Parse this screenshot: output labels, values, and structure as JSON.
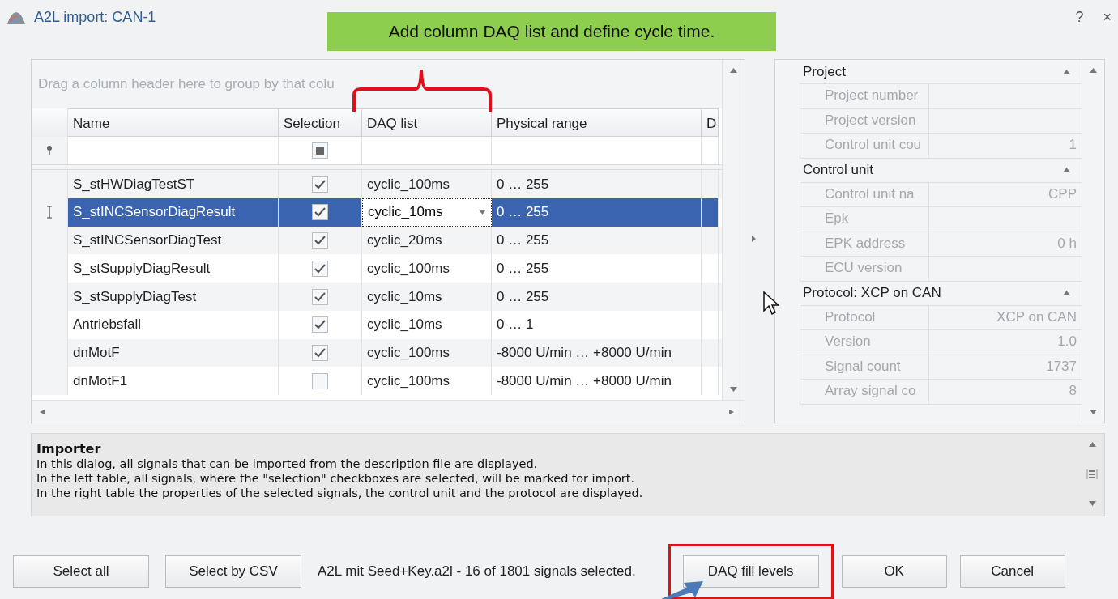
{
  "window": {
    "title": "A2L import: CAN-1",
    "help": "?",
    "close": "×"
  },
  "callout": {
    "text": "Add column DAQ list and define cycle time."
  },
  "grid": {
    "group_hint": "Drag a column header here to group by that colu",
    "columns": [
      {
        "label": "Name"
      },
      {
        "label": "Selection"
      },
      {
        "label": "DAQ list"
      },
      {
        "label": "Physical range"
      },
      {
        "label": "D"
      }
    ],
    "filter_indeterminate": true,
    "rows": [
      {
        "name": "S_stHWDiagTestST",
        "checked": true,
        "selected": false,
        "daq_list": "cyclic_100ms",
        "range": "0 … 255"
      },
      {
        "name": "S_stINCSensorDiagResult",
        "checked": true,
        "selected": true,
        "daq_list": "cyclic_10ms",
        "range": "0 … 255"
      },
      {
        "name": "S_stINCSensorDiagTest",
        "checked": true,
        "selected": false,
        "daq_list": "cyclic_20ms",
        "range": "0 … 255"
      },
      {
        "name": "S_stSupplyDiagResult",
        "checked": true,
        "selected": false,
        "daq_list": "cyclic_100ms",
        "range": "0 … 255"
      },
      {
        "name": "S_stSupplyDiagTest",
        "checked": true,
        "selected": false,
        "daq_list": "cyclic_10ms",
        "range": "0 … 255"
      },
      {
        "name": "Antriebsfall",
        "checked": true,
        "selected": false,
        "daq_list": "cyclic_10ms",
        "range": "0 … 1"
      },
      {
        "name": "dnMotF",
        "checked": true,
        "selected": false,
        "daq_list": "cyclic_100ms",
        "range": "-8000 U/min … +8000 U/min"
      },
      {
        "name": "dnMotF1",
        "checked": false,
        "selected": false,
        "daq_list": "cyclic_100ms",
        "range": "-8000 U/min … +8000 U/min"
      }
    ]
  },
  "properties": {
    "sections": [
      {
        "title": "Project",
        "expanded": true,
        "rows": [
          {
            "label": "Project number",
            "value": ""
          },
          {
            "label": "Project version",
            "value": ""
          },
          {
            "label": "Control unit cou",
            "value": "1"
          }
        ]
      },
      {
        "title": "Control unit",
        "expanded": true,
        "rows": [
          {
            "label": "Control unit na",
            "value": "CPP"
          },
          {
            "label": "Epk",
            "value": ""
          },
          {
            "label": "EPK address",
            "value": "0 h"
          },
          {
            "label": "ECU version",
            "value": ""
          }
        ]
      },
      {
        "title": "Protocol: XCP on CAN",
        "expanded": true,
        "rows": [
          {
            "label": "Protocol",
            "value": "XCP on CAN"
          },
          {
            "label": "Version",
            "value": "1.0"
          },
          {
            "label": "Signal count",
            "value": "1737"
          },
          {
            "label": "Array signal co",
            "value": "8"
          }
        ]
      }
    ]
  },
  "description": {
    "title": "Importer",
    "lines": [
      "In this dialog, all signals that can be imported from the description file are displayed.",
      "In the left table, all signals, where the \"selection\" checkboxes are selected, will be marked for import.",
      "In the right table the properties of the selected signals, the control unit and the protocol are displayed."
    ]
  },
  "footer": {
    "left_buttons": [
      {
        "label": "Select all"
      },
      {
        "label": "Select by CSV"
      }
    ],
    "status": "A2L mit Seed+Key.a2l  -  16 of 1801 signals selected.",
    "right_buttons": [
      {
        "label": "DAQ fill levels",
        "highlighted": true
      },
      {
        "label": "OK",
        "highlighted": false
      },
      {
        "label": "Cancel",
        "highlighted": false
      }
    ]
  }
}
